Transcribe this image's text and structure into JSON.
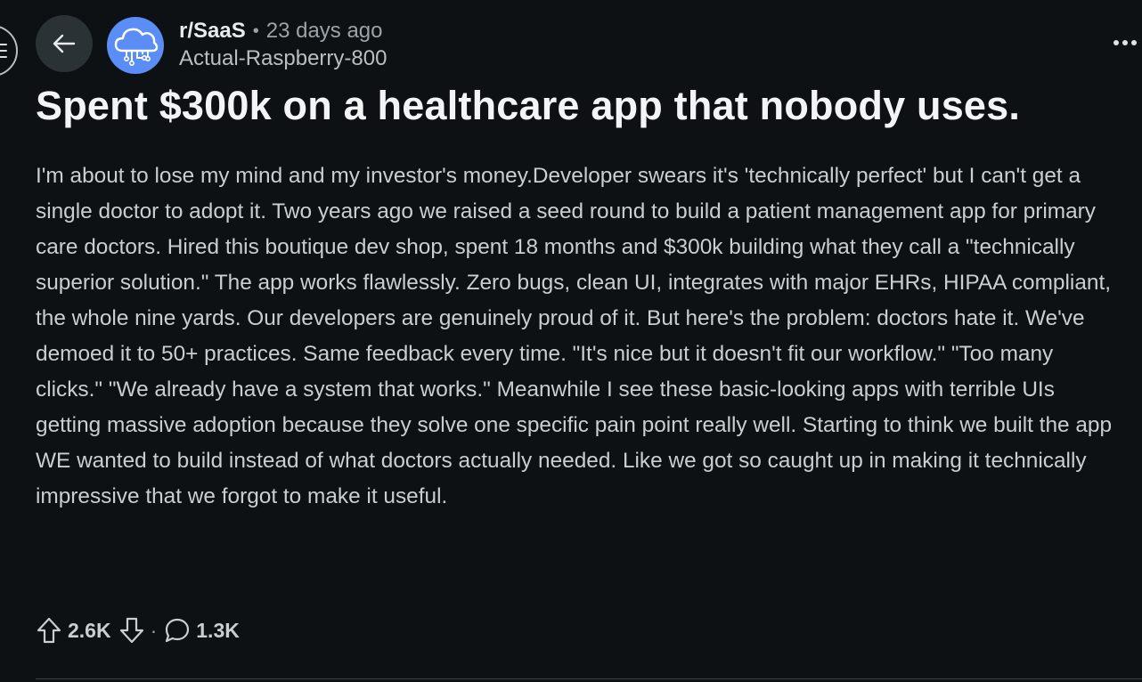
{
  "header": {
    "subreddit": "r/SaaS",
    "separator": "•",
    "time_ago": "23 days ago",
    "author": "Actual-Raspberry-800"
  },
  "post": {
    "title": "Spent $300k on a healthcare app that nobody uses.",
    "body": "I'm about to lose my mind and my investor's money.Developer swears it's 'technically perfect' but I can't get a single doctor to adopt it. Two years ago we raised a seed round to build a patient management app for primary care doctors. Hired this boutique dev shop, spent 18 months and $300k building what they call a \"technically superior solution.\" The app works flawlessly. Zero bugs, clean UI, integrates with major EHRs, HIPAA compliant, the whole nine yards. Our developers are genuinely proud of it. But here's the problem: doctors hate it. We've demoed it to 50+ practices. Same feedback every time. \"It's nice but it doesn't fit our workflow.\" \"Too many clicks.\" \"We already have a system that works.\" Meanwhile I see these basic-looking apps with terrible UIs getting massive adoption because they solve one specific pain point really well. Starting to think we built the app WE wanted to build instead of what doctors actually needed. Like we got so caught up in making it technically impressive that we forgot to make it useful."
  },
  "actions": {
    "upvotes": "2.6K",
    "separator": "·",
    "comments": "1.3K"
  },
  "icons": {
    "menu": "menu-icon",
    "back": "arrow-left-icon",
    "avatar": "cloud-network-icon",
    "more": "more-horizontal-icon",
    "upvote": "arrow-up-icon",
    "downvote": "arrow-down-icon",
    "comment": "comment-bubble-icon"
  },
  "colors": {
    "background": "#0e1113",
    "avatar_bg": "#5a8df5",
    "button_bg": "#2a3236",
    "text": "#c9ced2",
    "title": "#f2f4f5"
  }
}
